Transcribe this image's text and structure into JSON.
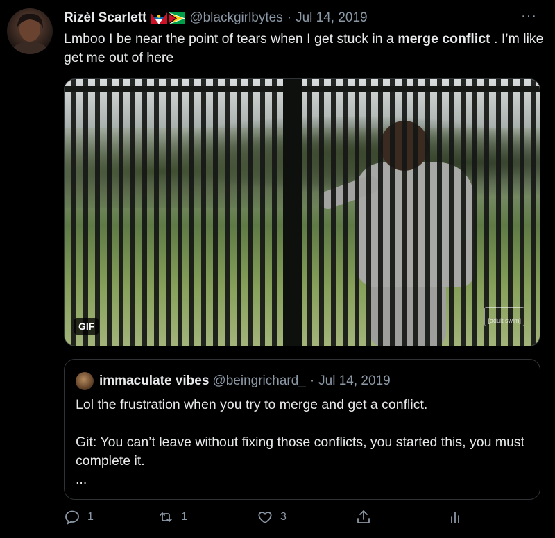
{
  "tweet": {
    "author_name": "Rizèl Scarlett",
    "flags": [
      "antigua-and-barbuda-flag",
      "guyana-flag"
    ],
    "handle": "@blackgirlbytes",
    "separator": "·",
    "date": "Jul 14, 2019",
    "more_label": "···",
    "text_before": "Lmboo I be near the point of tears when I get stuck in a ",
    "text_bold": "merge conflict",
    "text_after": " . I’m like get me out of here",
    "media": {
      "type": "gif",
      "badge": "GIF",
      "watermark": "[adult swim]"
    }
  },
  "quoted_tweet": {
    "author_name": "immaculate vibes",
    "handle": "@beingrichard_",
    "separator": "·",
    "date": "Jul 14, 2019",
    "line1": "Lol the frustration when you try to merge and get a conflict.",
    "line2": "Git: You can’t leave without fixing those conflicts, you started this, you must complete it.",
    "ellipsis": "..."
  },
  "actions": {
    "reply_count": "1",
    "retweet_count": "1",
    "like_count": "3",
    "share_icon": "share-icon",
    "analytics_icon": "analytics-icon"
  },
  "colors": {
    "background": "#000000",
    "text": "#e7e9ea",
    "secondary": "#8b98a5",
    "border": "#2f3336"
  }
}
